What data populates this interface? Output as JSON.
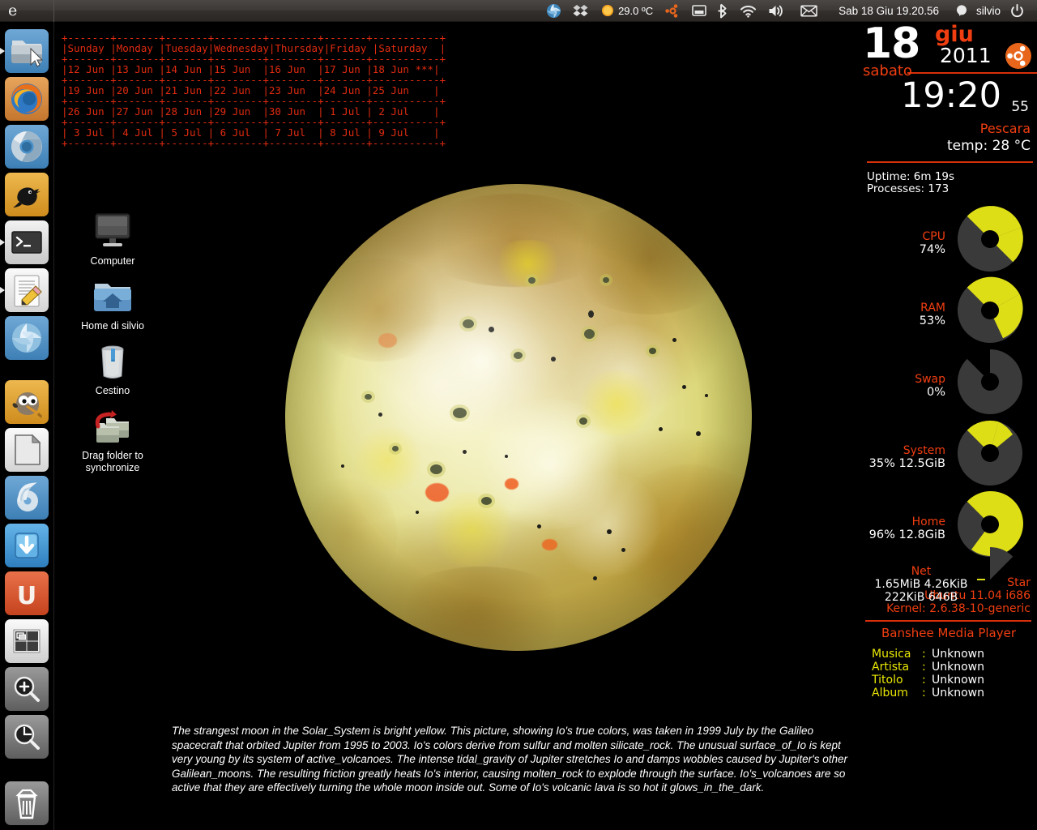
{
  "panel": {
    "logo": "e",
    "tray": [
      {
        "name": "shutter-icon",
        "label": "Shutter"
      },
      {
        "name": "dropbox-icon",
        "label": "Dropbox"
      },
      {
        "name": "weather-icon",
        "label": "Weather"
      },
      {
        "name": "weather-temp",
        "label": "29.0 ºC"
      },
      {
        "name": "ubuntu-one-icon",
        "label": "Ubuntu One"
      },
      {
        "name": "battery-icon",
        "label": "Battery"
      },
      {
        "name": "bluetooth-icon",
        "label": "Bluetooth"
      },
      {
        "name": "wifi-icon",
        "label": "Network"
      },
      {
        "name": "volume-icon",
        "label": "Volume"
      },
      {
        "name": "mail-icon",
        "label": "Messaging"
      }
    ],
    "clock": "Sab 18 Giu 19.20.56",
    "user": "silvio",
    "power": "Shutdown"
  },
  "launcher": {
    "items": [
      {
        "name": "nautilus",
        "label": "File Manager",
        "running": true
      },
      {
        "name": "firefox",
        "label": "Firefox",
        "running": false
      },
      {
        "name": "chromium",
        "label": "Chromium",
        "running": true
      },
      {
        "name": "bird-client",
        "label": "Twitter Client",
        "running": false
      },
      {
        "name": "terminal",
        "label": "Terminal",
        "running": true
      },
      {
        "name": "text-editor",
        "label": "Text Editor",
        "running": true
      },
      {
        "name": "shutter",
        "label": "Shutter",
        "running": false
      },
      {
        "name": "gimp",
        "label": "GIMP",
        "running": false
      },
      {
        "name": "libreoffice",
        "label": "LibreOffice",
        "running": false
      },
      {
        "name": "banshee",
        "label": "Banshee",
        "running": false
      },
      {
        "name": "download-manager",
        "label": "Download Manager",
        "running": false
      },
      {
        "name": "ubuntu-software",
        "label": "Ubuntu Software Center",
        "running": false
      },
      {
        "name": "workspace-switcher",
        "label": "Workspace Switcher",
        "running": false
      },
      {
        "name": "zoom-in",
        "label": "Zoom In",
        "running": false
      },
      {
        "name": "zoom-out",
        "label": "Zoom Out",
        "running": false
      },
      {
        "name": "trash",
        "label": "Trash",
        "running": false
      }
    ]
  },
  "calendar": {
    "text": "+-------+-------+-------+--------+--------+-------+-----------+\n|Sunday |Monday |Tuesday|Wednesday|Thursday|Friday |Saturday  |\n+-------+-------+-------+--------+--------+-------+-----------+\n|12 Jun |13 Jun |14 Jun |15 Jun  |16 Jun  |17 Jun |18 Jun ***|\n+-------+-------+-------+--------+--------+-------+-----------+\n|19 Jun |20 Jun |21 Jun |22 Jun  |23 Jun  |24 Jun |25 Jun    |\n+-------+-------+-------+--------+--------+-------+-----------+\n|26 Jun |27 Jun |28 Jun |29 Jun  |30 Jun  | 1 Jul | 2 Jul    |\n+-------+-------+-------+--------+--------+-------+-----------+\n| 3 Jul | 4 Jul | 5 Jul | 6 Jul  | 7 Jul  | 8 Jul | 9 Jul    |\n+-------+-------+-------+--------+--------+-------+-----------+",
    "headers": [
      "Sunday",
      "Monday",
      "Tuesday",
      "Wednesday",
      "Thursday",
      "Friday",
      "Saturday"
    ],
    "weeks": [
      [
        "12 Jun",
        "13 Jun",
        "14 Jun",
        "15 Jun",
        "16 Jun",
        "17 Jun",
        "18 Jun ***"
      ],
      [
        "19 Jun",
        "20 Jun",
        "21 Jun",
        "22 Jun",
        "23 Jun",
        "24 Jun",
        "25 Jun"
      ],
      [
        "26 Jun",
        "27 Jun",
        "28 Jun",
        "29 Jun",
        "30 Jun",
        " 1 Jul",
        " 2 Jul"
      ],
      [
        " 3 Jul",
        " 4 Jul",
        " 5 Jul",
        " 6 Jul",
        " 7 Jul",
        " 8 Jul",
        " 9 Jul"
      ]
    ],
    "color": "#e02b10"
  },
  "desktop_icons": [
    {
      "name": "computer",
      "label": "Computer"
    },
    {
      "name": "home-folder",
      "label": "Home di silvio"
    },
    {
      "name": "trash",
      "label": "Cestino"
    },
    {
      "name": "sync-folder",
      "label": "Drag folder to synchronize"
    }
  ],
  "caption": {
    "text": "The strangest moon in the Solar_System is bright yellow. This picture, showing Io's true colors, was taken in 1999 July by the Galileo spacecraft that orbited Jupiter from 1995 to 2003. Io's colors derive from sulfur and molten silicate_rock. The unusual surface_of_Io is kept very young by its system of active_volcanoes. The intense tidal_gravity of Jupiter stretches Io and damps wobbles caused by Jupiter's other Galilean_moons. The resulting friction greatly heats Io's interior, causing molten_rock to explode through the surface. Io's_volcanoes are so active that they are effectively turning the whole moon inside out. Some of Io's volcanic lava is so hot it glows_in_the_dark."
  },
  "conky": {
    "day": "18",
    "month": "giu",
    "year": "2011",
    "weekday": "sabato",
    "time": "19:20",
    "seconds": "55",
    "city": "Pescara",
    "temp": "temp: 28 °C",
    "uptime": "Uptime: 6m 19s",
    "processes": "Processes: 173",
    "stats": [
      {
        "name": "cpu",
        "label": "CPU",
        "value": "74%",
        "percent": 74
      },
      {
        "name": "ram",
        "label": "RAM",
        "value": "53%",
        "percent": 53
      },
      {
        "name": "swap",
        "label": "Swap",
        "value": "0%",
        "percent": 0
      },
      {
        "name": "system",
        "label": "System",
        "value": "35% 12.5GiB",
        "percent": 35
      },
      {
        "name": "home",
        "label": "Home",
        "value": "96% 12.8GiB",
        "percent": 96
      },
      {
        "name": "net-gauge",
        "label": "",
        "value": "",
        "percent": 4
      }
    ],
    "net": {
      "label": "Net",
      "line1": "1.65MiB 4.26KiB",
      "line2": "222KiB 646B"
    },
    "system_info": {
      "host": "Star",
      "distro": "Ubuntu 11.04  i686",
      "kernel": "Kernel: 2.6.38-10-generic"
    },
    "banshee": {
      "title": "Banshee Media Player",
      "rows": [
        {
          "key": "Musica",
          "sep": ":",
          "value": "Unknown"
        },
        {
          "key": "Artista",
          "sep": ":",
          "value": "Unknown"
        },
        {
          "key": "Titolo",
          "sep": ":",
          "value": "Unknown"
        },
        {
          "key": "Album",
          "sep": ":",
          "value": "Unknown"
        }
      ]
    },
    "colors": {
      "accent_red": "#f03e11",
      "gauge_fill": "#dede17",
      "gauge_track": "#3a3a3a",
      "text_white": "#ffffff",
      "key_yellow": "#e9e800"
    }
  }
}
